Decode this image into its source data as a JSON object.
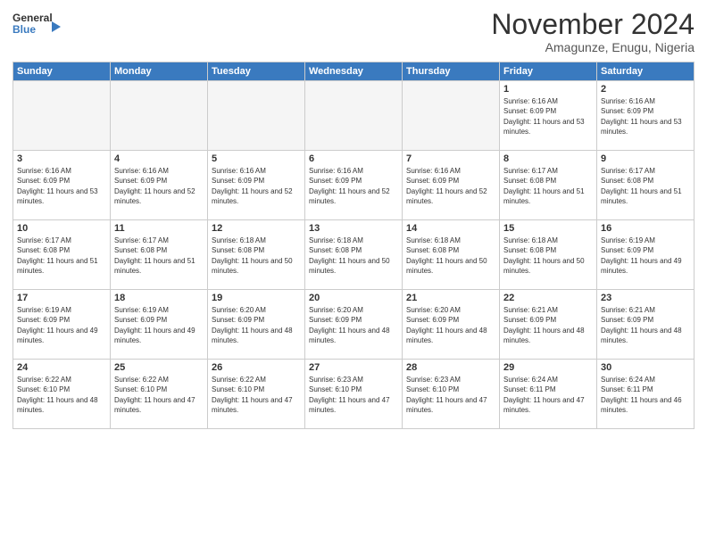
{
  "logo": {
    "line1": "General",
    "line2": "Blue"
  },
  "title": "November 2024",
  "location": "Amagunze, Enugu, Nigeria",
  "days_of_week": [
    "Sunday",
    "Monday",
    "Tuesday",
    "Wednesday",
    "Thursday",
    "Friday",
    "Saturday"
  ],
  "weeks": [
    [
      {
        "day": "",
        "empty": true
      },
      {
        "day": "",
        "empty": true
      },
      {
        "day": "",
        "empty": true
      },
      {
        "day": "",
        "empty": true
      },
      {
        "day": "",
        "empty": true
      },
      {
        "day": "1",
        "sunrise": "6:16 AM",
        "sunset": "6:09 PM",
        "daylight": "11 hours and 53 minutes."
      },
      {
        "day": "2",
        "sunrise": "6:16 AM",
        "sunset": "6:09 PM",
        "daylight": "11 hours and 53 minutes."
      }
    ],
    [
      {
        "day": "3",
        "sunrise": "6:16 AM",
        "sunset": "6:09 PM",
        "daylight": "11 hours and 53 minutes."
      },
      {
        "day": "4",
        "sunrise": "6:16 AM",
        "sunset": "6:09 PM",
        "daylight": "11 hours and 52 minutes."
      },
      {
        "day": "5",
        "sunrise": "6:16 AM",
        "sunset": "6:09 PM",
        "daylight": "11 hours and 52 minutes."
      },
      {
        "day": "6",
        "sunrise": "6:16 AM",
        "sunset": "6:09 PM",
        "daylight": "11 hours and 52 minutes."
      },
      {
        "day": "7",
        "sunrise": "6:16 AM",
        "sunset": "6:09 PM",
        "daylight": "11 hours and 52 minutes."
      },
      {
        "day": "8",
        "sunrise": "6:17 AM",
        "sunset": "6:08 PM",
        "daylight": "11 hours and 51 minutes."
      },
      {
        "day": "9",
        "sunrise": "6:17 AM",
        "sunset": "6:08 PM",
        "daylight": "11 hours and 51 minutes."
      }
    ],
    [
      {
        "day": "10",
        "sunrise": "6:17 AM",
        "sunset": "6:08 PM",
        "daylight": "11 hours and 51 minutes."
      },
      {
        "day": "11",
        "sunrise": "6:17 AM",
        "sunset": "6:08 PM",
        "daylight": "11 hours and 51 minutes."
      },
      {
        "day": "12",
        "sunrise": "6:18 AM",
        "sunset": "6:08 PM",
        "daylight": "11 hours and 50 minutes."
      },
      {
        "day": "13",
        "sunrise": "6:18 AM",
        "sunset": "6:08 PM",
        "daylight": "11 hours and 50 minutes."
      },
      {
        "day": "14",
        "sunrise": "6:18 AM",
        "sunset": "6:08 PM",
        "daylight": "11 hours and 50 minutes."
      },
      {
        "day": "15",
        "sunrise": "6:18 AM",
        "sunset": "6:08 PM",
        "daylight": "11 hours and 50 minutes."
      },
      {
        "day": "16",
        "sunrise": "6:19 AM",
        "sunset": "6:09 PM",
        "daylight": "11 hours and 49 minutes."
      }
    ],
    [
      {
        "day": "17",
        "sunrise": "6:19 AM",
        "sunset": "6:09 PM",
        "daylight": "11 hours and 49 minutes."
      },
      {
        "day": "18",
        "sunrise": "6:19 AM",
        "sunset": "6:09 PM",
        "daylight": "11 hours and 49 minutes."
      },
      {
        "day": "19",
        "sunrise": "6:20 AM",
        "sunset": "6:09 PM",
        "daylight": "11 hours and 48 minutes."
      },
      {
        "day": "20",
        "sunrise": "6:20 AM",
        "sunset": "6:09 PM",
        "daylight": "11 hours and 48 minutes."
      },
      {
        "day": "21",
        "sunrise": "6:20 AM",
        "sunset": "6:09 PM",
        "daylight": "11 hours and 48 minutes."
      },
      {
        "day": "22",
        "sunrise": "6:21 AM",
        "sunset": "6:09 PM",
        "daylight": "11 hours and 48 minutes."
      },
      {
        "day": "23",
        "sunrise": "6:21 AM",
        "sunset": "6:09 PM",
        "daylight": "11 hours and 48 minutes."
      }
    ],
    [
      {
        "day": "24",
        "sunrise": "6:22 AM",
        "sunset": "6:10 PM",
        "daylight": "11 hours and 48 minutes."
      },
      {
        "day": "25",
        "sunrise": "6:22 AM",
        "sunset": "6:10 PM",
        "daylight": "11 hours and 47 minutes."
      },
      {
        "day": "26",
        "sunrise": "6:22 AM",
        "sunset": "6:10 PM",
        "daylight": "11 hours and 47 minutes."
      },
      {
        "day": "27",
        "sunrise": "6:23 AM",
        "sunset": "6:10 PM",
        "daylight": "11 hours and 47 minutes."
      },
      {
        "day": "28",
        "sunrise": "6:23 AM",
        "sunset": "6:10 PM",
        "daylight": "11 hours and 47 minutes."
      },
      {
        "day": "29",
        "sunrise": "6:24 AM",
        "sunset": "6:11 PM",
        "daylight": "11 hours and 47 minutes."
      },
      {
        "day": "30",
        "sunrise": "6:24 AM",
        "sunset": "6:11 PM",
        "daylight": "11 hours and 46 minutes."
      }
    ]
  ]
}
